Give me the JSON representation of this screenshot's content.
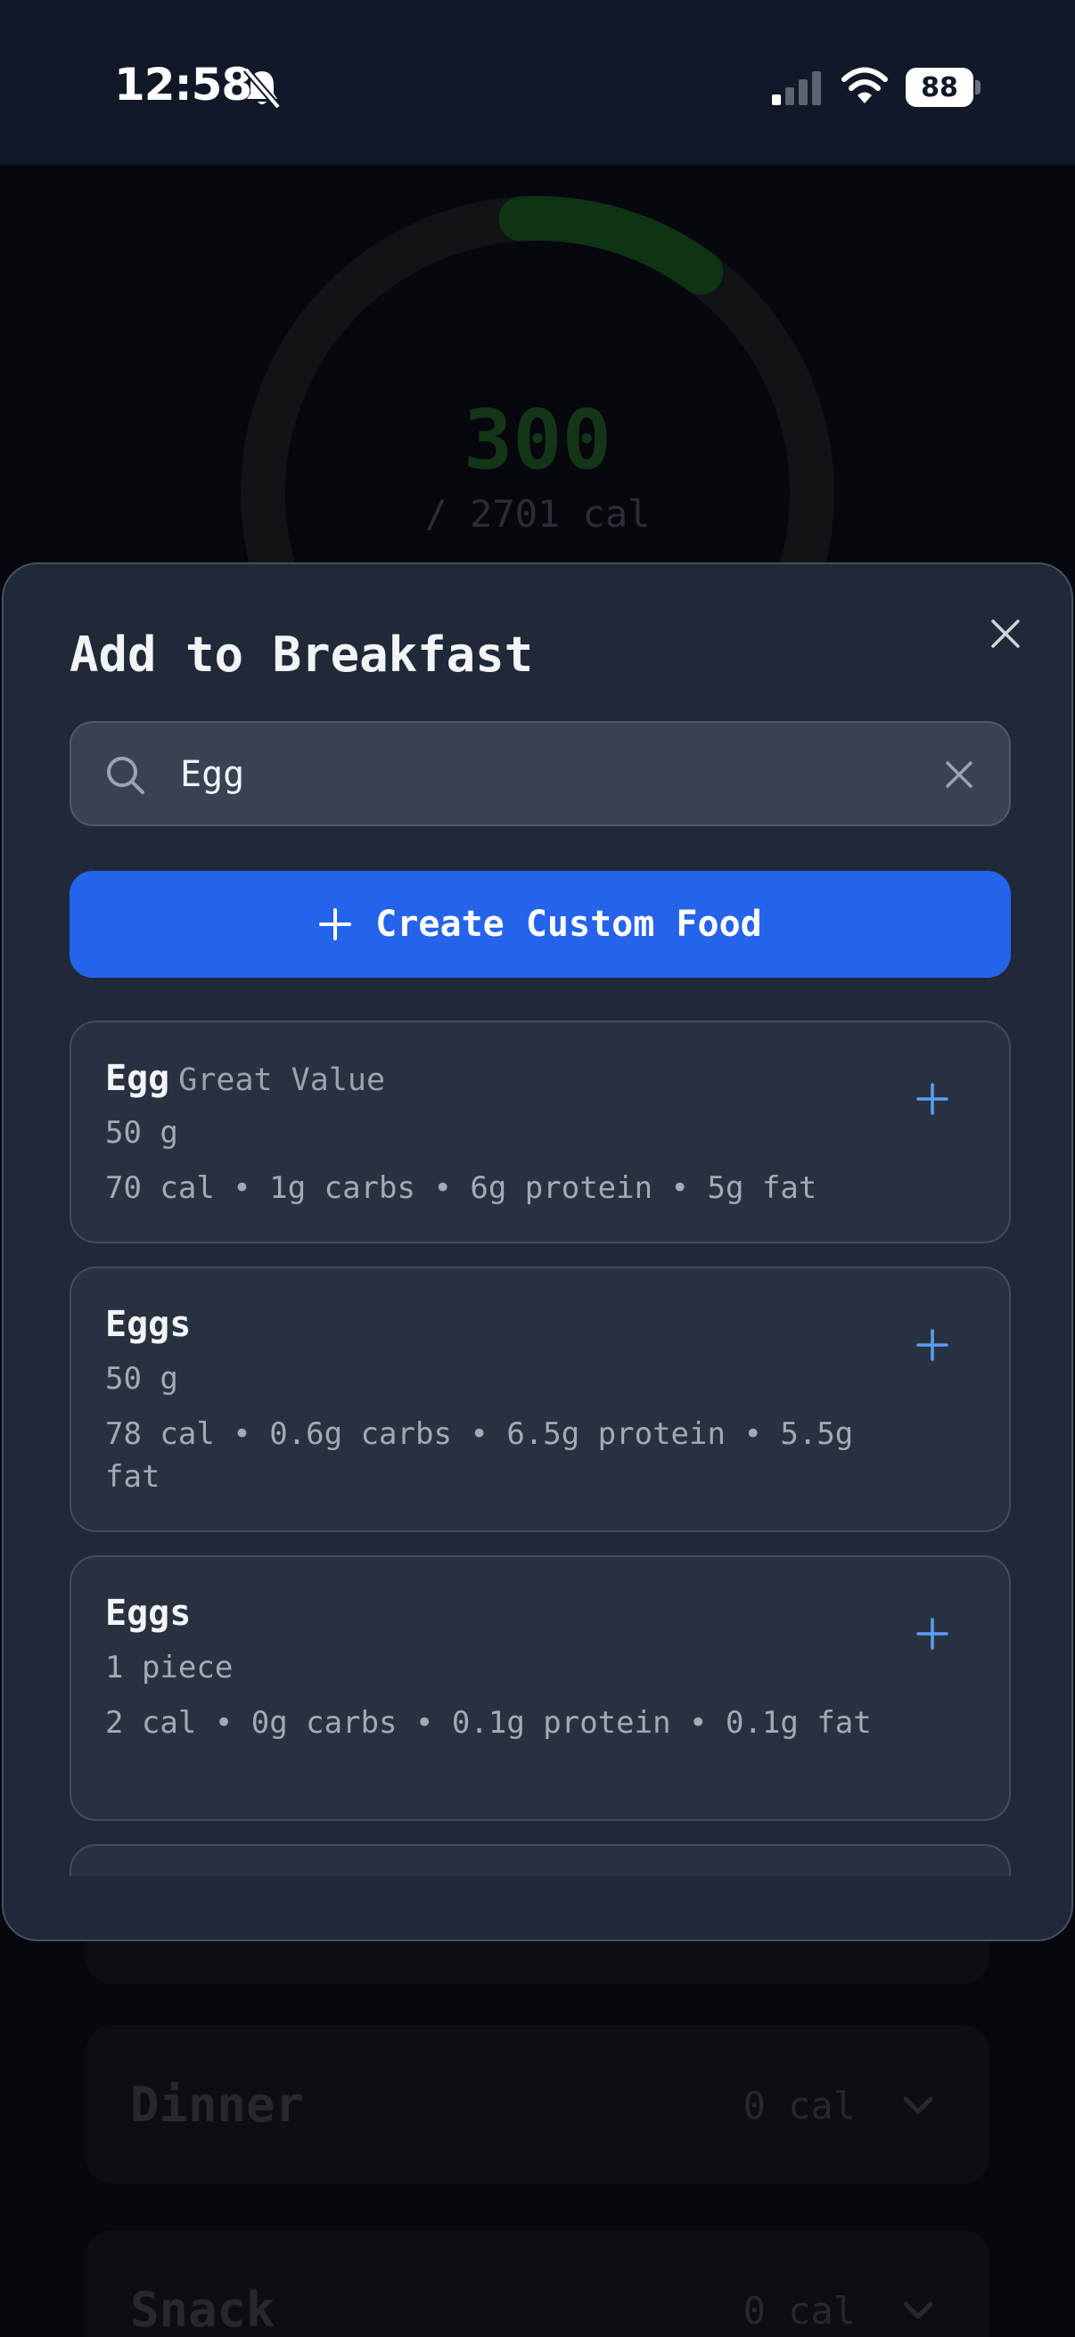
{
  "status_bar": {
    "time": "12:58",
    "battery": "88",
    "icons": [
      "bell-slash-icon",
      "signal-icon",
      "wifi-icon",
      "battery-icon"
    ]
  },
  "background": {
    "calories_consumed": "300",
    "calories_goal": "/ 2701 cal",
    "calorie_progress": 0.111,
    "meals": [
      {
        "name": "Dinner",
        "calories": "0 cal"
      },
      {
        "name": "Snack",
        "calories": "0 cal"
      }
    ]
  },
  "modal": {
    "title": "Add to Breakfast",
    "search": {
      "value": "Egg"
    },
    "create_label": "Create Custom Food",
    "results": [
      {
        "name": "Egg",
        "brand": "Great Value",
        "serving": "50 g",
        "macros": "70 cal • 1g carbs • 6g protein • 5g fat"
      },
      {
        "name": "Eggs",
        "brand": "",
        "serving": "50 g",
        "macros": "78 cal • 0.6g carbs • 6.5g protein • 5.5g fat"
      },
      {
        "name": "Eggs",
        "brand": "",
        "serving": "1 piece",
        "macros": "2 cal • 0g carbs • 0.1g protein • 0.1g fat"
      }
    ]
  },
  "colors": {
    "accent": "#2563eb",
    "add_icon": "#5b9cf5",
    "sheet_bg": "#1f2937",
    "card_bg": "#283140"
  }
}
